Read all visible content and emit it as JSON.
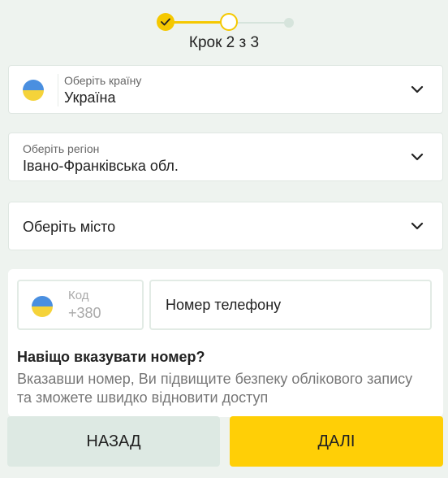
{
  "stepper": {
    "label": "Крок 2 з 3",
    "current_step": 2,
    "total_steps": 3,
    "accent_color": "#f5c800"
  },
  "country": {
    "label": "Оберіть країну",
    "value": "Україна",
    "flag_icon": "ukraine-flag-icon"
  },
  "region": {
    "label": "Оберіть регіон",
    "value": "Івано-Франківська обл."
  },
  "city": {
    "placeholder": "Оберіть місто"
  },
  "phone": {
    "code_label": "Код",
    "code_value": "+380",
    "number_placeholder": "Номер телефону",
    "why_title": "Навіщо вказувати номер?",
    "why_text": "Вказавши номер, Ви підвищите безпеку облікового запису та зможете швидко відновити доступ"
  },
  "buttons": {
    "back": "НАЗАД",
    "next": "ДАЛІ",
    "next_color": "#ffcf06"
  }
}
